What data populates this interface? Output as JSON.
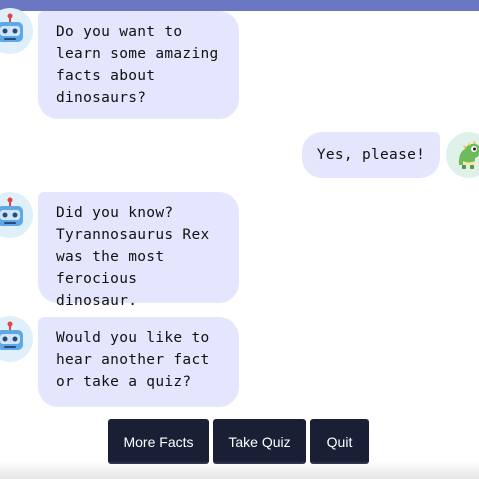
{
  "messages": [
    {
      "sender": "bot",
      "text": "Do you want to\nlearn some amazing\nfacts about\ndinosaurs?"
    },
    {
      "sender": "user",
      "text": "Yes, please!"
    },
    {
      "sender": "bot",
      "text": "Did you know?\nTyrannosaurus Rex\nwas the most\nferocious dinosaur."
    },
    {
      "sender": "bot",
      "text": "Would you like to\nhear another fact\nor take a quiz?"
    }
  ],
  "actions": {
    "more_facts": "More Facts",
    "take_quiz": "Take Quiz",
    "quit": "Quit"
  },
  "colors": {
    "header": "#6b77c2",
    "bubble": "#e4e6fd",
    "button": "#1b1f36"
  },
  "icons": {
    "bot_avatar": "robot-icon",
    "user_avatar": "dinosaur-icon"
  }
}
